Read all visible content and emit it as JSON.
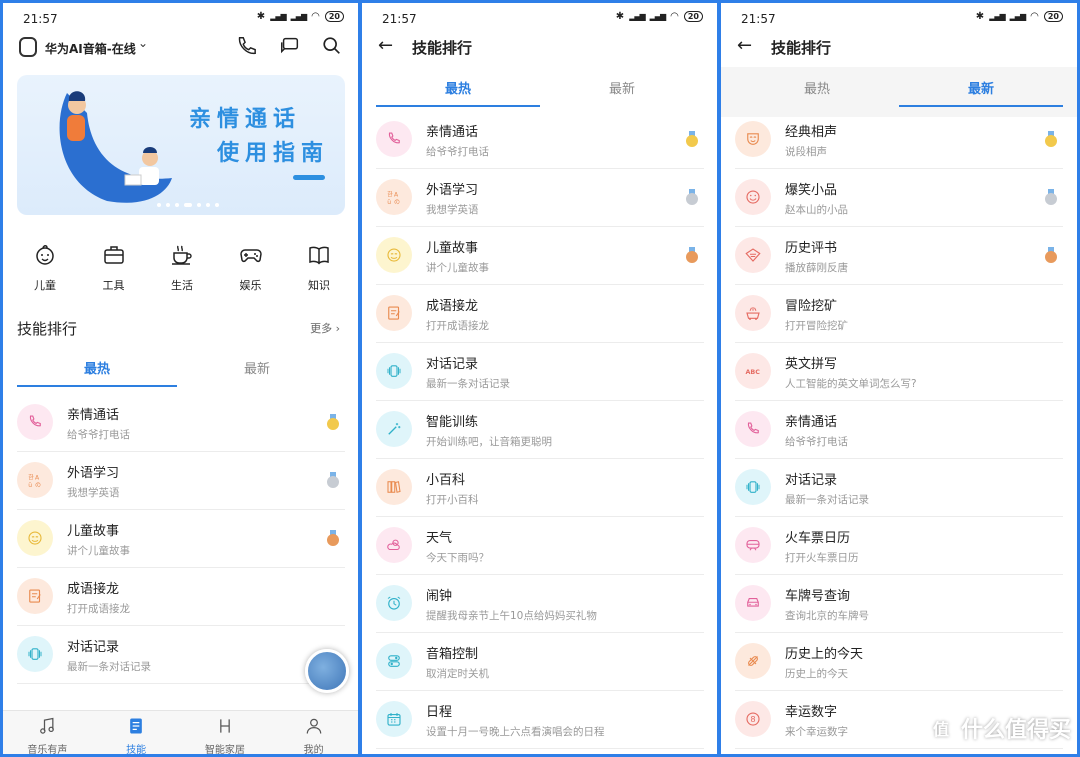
{
  "status": {
    "time": "21:57",
    "battery": "20"
  },
  "panel1": {
    "device_name": "华为AI音箱-在线",
    "banner": {
      "line1": "亲情通话",
      "line2": "使用指南"
    },
    "categories": [
      {
        "label": "儿童",
        "icon": "child-icon"
      },
      {
        "label": "工具",
        "icon": "toolbox-icon"
      },
      {
        "label": "生活",
        "icon": "coffee-cup-icon"
      },
      {
        "label": "娱乐",
        "icon": "gamepad-icon"
      },
      {
        "label": "知识",
        "icon": "book-icon"
      }
    ],
    "section_title": "技能排行",
    "more": "更多",
    "tabs": [
      "最热",
      "最新"
    ],
    "items": [
      {
        "title": "亲情通话",
        "sub": "给爷爷打电话",
        "medal": "gold"
      },
      {
        "title": "外语学习",
        "sub": "我想学英语",
        "medal": "silver"
      },
      {
        "title": "儿童故事",
        "sub": "讲个儿童故事",
        "medal": "bronze"
      },
      {
        "title": "成语接龙",
        "sub": "打开成语接龙",
        "medal": ""
      },
      {
        "title": "对话记录",
        "sub": "最新一条对话记录",
        "medal": ""
      }
    ],
    "nav": [
      {
        "label": "音乐有声",
        "icon": "music-note-icon"
      },
      {
        "label": "技能",
        "icon": "skills-icon"
      },
      {
        "label": "智能家居",
        "icon": "smart-home-icon"
      },
      {
        "label": "我的",
        "icon": "person-icon"
      }
    ]
  },
  "panel2": {
    "title": "技能排行",
    "tabs": [
      "最热",
      "最新"
    ],
    "items": [
      {
        "title": "亲情通话",
        "sub": "给爷爷打电话",
        "medal": "gold"
      },
      {
        "title": "外语学习",
        "sub": "我想学英语",
        "medal": "silver"
      },
      {
        "title": "儿童故事",
        "sub": "讲个儿童故事",
        "medal": "bronze"
      },
      {
        "title": "成语接龙",
        "sub": "打开成语接龙",
        "medal": ""
      },
      {
        "title": "对话记录",
        "sub": "最新一条对话记录",
        "medal": ""
      },
      {
        "title": "智能训练",
        "sub": "开始训练吧，让音箱更聪明",
        "medal": ""
      },
      {
        "title": "小百科",
        "sub": "打开小百科",
        "medal": ""
      },
      {
        "title": "天气",
        "sub": "今天下雨吗？",
        "medal": ""
      },
      {
        "title": "闹钟",
        "sub": "提醒我母亲节上午10点给妈妈买礼物",
        "medal": ""
      },
      {
        "title": "音箱控制",
        "sub": "取消定时关机",
        "medal": ""
      },
      {
        "title": "日程",
        "sub": "设置十月一号晚上六点看演唱会的日程",
        "medal": ""
      }
    ]
  },
  "panel3": {
    "title": "技能排行",
    "tabs": [
      "最热",
      "最新"
    ],
    "items": [
      {
        "title": "经典相声",
        "sub": "说段相声",
        "medal": "gold"
      },
      {
        "title": "爆笑小品",
        "sub": "赵本山的小品",
        "medal": "silver"
      },
      {
        "title": "历史评书",
        "sub": "播放薛刚反唐",
        "medal": "bronze"
      },
      {
        "title": "冒险挖矿",
        "sub": "打开冒险挖矿",
        "medal": ""
      },
      {
        "title": "英文拼写",
        "sub": "人工智能的英文单词怎么写?",
        "medal": ""
      },
      {
        "title": "亲情通话",
        "sub": "给爷爷打电话",
        "medal": ""
      },
      {
        "title": "对话记录",
        "sub": "最新一条对话记录",
        "medal": ""
      },
      {
        "title": "火车票日历",
        "sub": "打开火车票日历",
        "medal": ""
      },
      {
        "title": "车牌号查询",
        "sub": "查询北京的车牌号",
        "medal": ""
      },
      {
        "title": "历史上的今天",
        "sub": "历史上的今天",
        "medal": ""
      },
      {
        "title": "幸运数字",
        "sub": "来个幸运数字",
        "medal": ""
      }
    ]
  },
  "watermark": "什么值得买",
  "colors": {
    "accent": "#2d7fe0",
    "gold": "#f2c94c",
    "silver": "#c7ccd3",
    "bronze": "#e89a5c"
  }
}
